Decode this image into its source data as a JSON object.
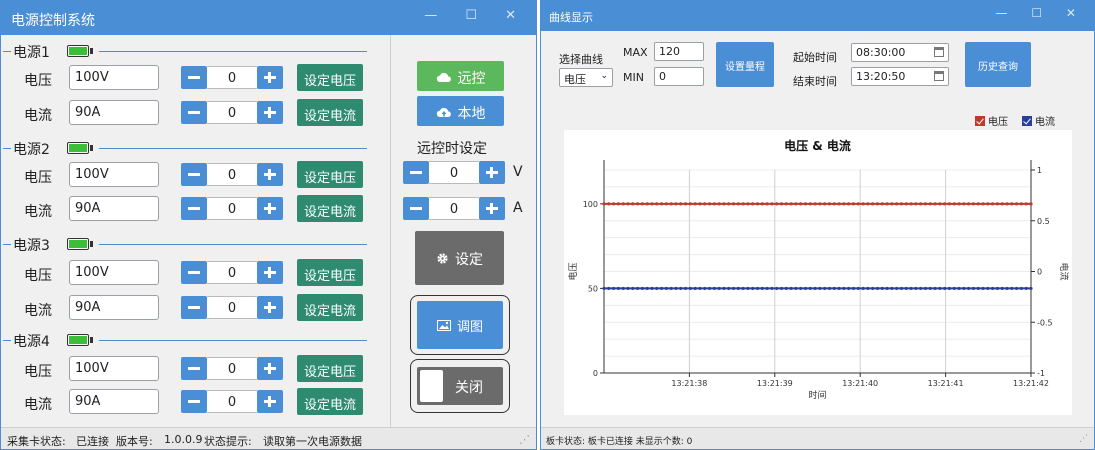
{
  "power_window": {
    "title": "电源控制系统",
    "groups": [
      {
        "title": "电源1",
        "voltage_label": "电压",
        "voltage_value": "100V",
        "voltage_step": "0",
        "voltage_btn": "设定电压",
        "current_label": "电流",
        "current_value": "90A",
        "current_step": "0",
        "current_btn": "设定电流"
      },
      {
        "title": "电源2",
        "voltage_label": "电压",
        "voltage_value": "100V",
        "voltage_step": "0",
        "voltage_btn": "设定电压",
        "current_label": "电流",
        "current_value": "90A",
        "current_step": "0",
        "current_btn": "设定电流"
      },
      {
        "title": "电源3",
        "voltage_label": "电压",
        "voltage_value": "100V",
        "voltage_step": "0",
        "voltage_btn": "设定电压",
        "current_label": "电流",
        "current_value": "90A",
        "current_step": "0",
        "current_btn": "设定电流"
      },
      {
        "title": "电源4",
        "voltage_label": "电压",
        "voltage_value": "100V",
        "voltage_step": "0",
        "voltage_btn": "设定电压",
        "current_label": "电流",
        "current_value": "90A",
        "current_step": "0",
        "current_btn": "设定电流"
      }
    ],
    "remote_btn": "远控",
    "local_btn": "本地",
    "remote_setting_title": "远控时设定",
    "remote_voltage": {
      "value": "0",
      "unit": "V"
    },
    "remote_current": {
      "value": "0",
      "unit": "A"
    },
    "settings_btn": "设定",
    "curve_btn": "调图",
    "close_btn": "关闭",
    "status": {
      "card_label": "采集卡状态:",
      "card_value": "已连接",
      "version_label": "版本号:",
      "version_value": "1.0.0.9",
      "hint_label": "状态提示:",
      "hint_value": "读取第一次电源数据"
    }
  },
  "curve_window": {
    "title": "曲线显示",
    "select_curve_label": "选择曲线",
    "select_curve_value": "电压",
    "max_label": "MAX",
    "max_value": "120",
    "min_label": "MIN",
    "min_value": "0",
    "set_range_btn": "设置量程",
    "start_time_label": "起始时间",
    "start_time_value": "08:30:00",
    "end_time_label": "结束时间",
    "end_time_value": "13:20:50",
    "history_btn": "历史查询",
    "status": {
      "text": "板卡状态:  板卡已连接  未显示个数:  0"
    }
  },
  "chart_data": {
    "type": "line",
    "title": "电压 & 电流",
    "xlabel": "时间",
    "ylabel": "电压",
    "y2label": "电流",
    "xticks": [
      "13:21:38",
      "13:21:39",
      "13:21:40",
      "13:21:41",
      "13:21:42"
    ],
    "yticks": [
      0,
      50,
      100
    ],
    "y2ticks": [
      -1,
      -0.5,
      0,
      0.5,
      1
    ],
    "ylim": [
      0,
      120
    ],
    "y2lim": [
      -1,
      1
    ],
    "grid": true,
    "legend_position": "top-right",
    "series": [
      {
        "name": "电压",
        "color": "#c0392b",
        "value": 100,
        "points": 90
      },
      {
        "name": "电流",
        "color": "#2c3e9c",
        "value": 50,
        "points": 90
      }
    ]
  },
  "colors": {
    "accent": "#4a8fd6",
    "set_btn": "#2e8b70",
    "remote_green": "#5cb85c",
    "gray_btn": "#6b6b6b"
  }
}
